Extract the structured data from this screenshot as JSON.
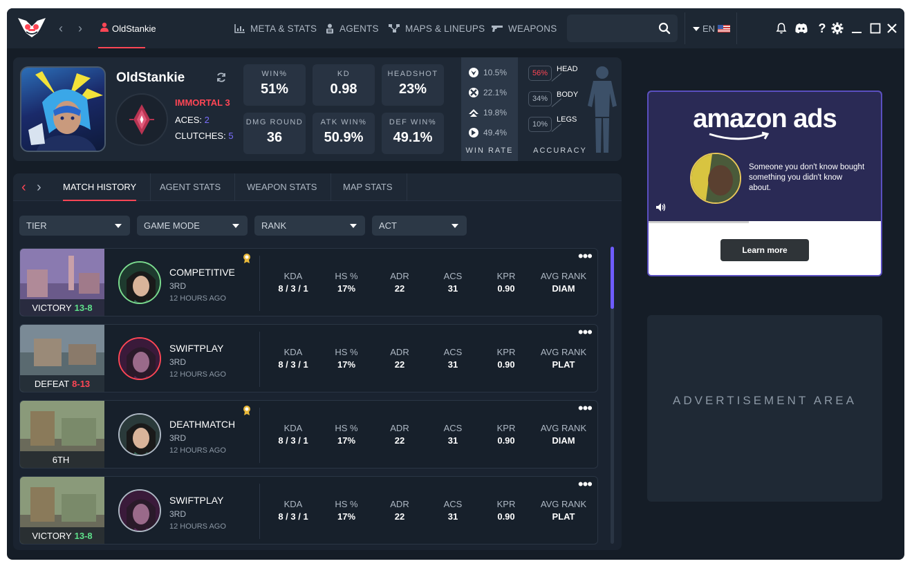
{
  "app": {
    "title": "OldStankie"
  },
  "header": {
    "username": "OldStankie",
    "nav": [
      {
        "label": "META & STATS",
        "icon": "bar-chart-icon"
      },
      {
        "label": "AGENTS",
        "icon": "agents-icon"
      },
      {
        "label": "MAPS & LINEUPS",
        "icon": "map-nodes-icon"
      },
      {
        "label": "WEAPONS",
        "icon": "gun-icon"
      }
    ],
    "search": {
      "placeholder": ""
    },
    "language": "EN"
  },
  "profile": {
    "name": "OldStankie",
    "rank": "IMMORTAL 3",
    "aces_label": "ACES:",
    "aces": "2",
    "clutches_label": "CLUTCHES:",
    "clutches": "5",
    "stats": [
      {
        "label": "WIN%",
        "value": "51%"
      },
      {
        "label": "KD",
        "value": "0.98"
      },
      {
        "label": "HEADSHOT",
        "value": "23%"
      },
      {
        "label": "DMG ROUND",
        "value": "36"
      },
      {
        "label": "ATK WIN%",
        "value": "50.9%"
      },
      {
        "label": "DEF WIN%",
        "value": "49.1%"
      }
    ],
    "win_rate": {
      "title": "WIN RATE",
      "rows": [
        {
          "icon": "competitive-icon",
          "value": "10.5%"
        },
        {
          "icon": "unrated-icon",
          "value": "22.1%"
        },
        {
          "icon": "swiftplay-icon",
          "value": "19.8%"
        },
        {
          "icon": "spike-rush-icon",
          "value": "49.4%"
        }
      ]
    },
    "accuracy": {
      "title": "ACCURACY",
      "rows": [
        {
          "label": "HEAD",
          "value": "56%",
          "highlight": "#ff4655"
        },
        {
          "label": "BODY",
          "value": "34%",
          "highlight": "#aeb8c4"
        },
        {
          "label": "LEGS",
          "value": "10%",
          "highlight": "#aeb8c4"
        }
      ]
    }
  },
  "tabs": [
    {
      "label": "MATCH HISTORY",
      "active": true
    },
    {
      "label": "AGENT STATS",
      "active": false
    },
    {
      "label": "WEAPON STATS",
      "active": false
    },
    {
      "label": "MAP STATS",
      "active": false
    }
  ],
  "filters": [
    {
      "label": "TIER"
    },
    {
      "label": "GAME MODE"
    },
    {
      "label": "RANK"
    },
    {
      "label": "ACT"
    }
  ],
  "stat_headers": [
    "KDA",
    "HS %",
    "ADR",
    "ACS",
    "KPR",
    "AVG RANK"
  ],
  "matches": [
    {
      "result": "VICTORY",
      "score": "13-8",
      "score_color": "#5ee08a",
      "mode": "COMPETITIVE",
      "place": "3RD",
      "time": "12 HOURS AGO",
      "medal": true,
      "agent_ring": "#7bdc8e",
      "stats": [
        "8 / 3 / 1",
        "17%",
        "22",
        "31",
        "0.90",
        "DIAM"
      ]
    },
    {
      "result": "DEFEAT",
      "score": "8-13",
      "score_color": "#ff4655",
      "mode": "SWIFTPLAY",
      "place": "3RD",
      "time": "12 HOURS AGO",
      "medal": false,
      "agent_ring": "#ff4655",
      "stats": [
        "8 / 3 / 1",
        "17%",
        "22",
        "31",
        "0.90",
        "PLAT"
      ]
    },
    {
      "result": "6TH",
      "score": "",
      "score_color": "#ffffff",
      "mode": "DEATHMATCH",
      "place": "3RD",
      "time": "12 HOURS AGO",
      "medal": true,
      "agent_ring": "#aeb8c4",
      "stats": [
        "8 / 3 / 1",
        "17%",
        "22",
        "31",
        "0.90",
        "DIAM"
      ]
    },
    {
      "result": "VICTORY",
      "score": "13-8",
      "score_color": "#5ee08a",
      "mode": "SWIFTPLAY",
      "place": "3RD",
      "time": "12 HOURS AGO",
      "medal": false,
      "agent_ring": "#aeb8c4",
      "stats": [
        "8 / 3 / 1",
        "17%",
        "22",
        "31",
        "0.90",
        "PLAT"
      ]
    }
  ],
  "ads": {
    "brand": "amazon ads",
    "message": "Someone you don't know bought something you didn't know about.",
    "cta": "Learn more",
    "placeholder": "ADVERTISEMENT AREA"
  },
  "colors": {
    "accent": "#ff4655",
    "purple": "#6e5cff",
    "panel": "#1e2835"
  }
}
